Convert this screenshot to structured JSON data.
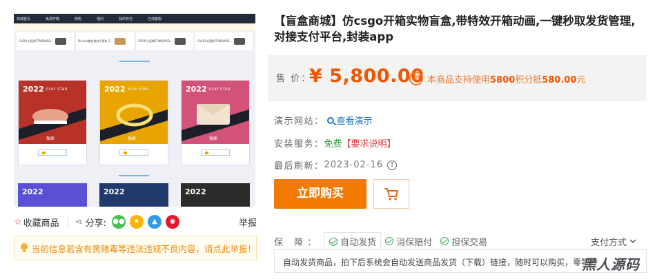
{
  "preview": {
    "nav": [
      "商城首页",
      "免费开箱",
      "换购",
      "福利",
      "我的背包",
      "在线客服"
    ],
    "strip_items": [
      "CASIO卡西欧STANDARD...",
      "Dickies腋包收纳手提包 2...",
      "CASIO卡西欧STANDARD...",
      "CASIO卡西欧STANDARD..."
    ],
    "cards": [
      {
        "year": "2022",
        "tag": "PLAY STAR",
        "color": "#c0392b"
      },
      {
        "year": "2022",
        "tag": "PLAY STAR",
        "color": "#e8a400"
      },
      {
        "year": "2022",
        "tag": "PLAY STAR",
        "color": "#d2527a"
      }
    ],
    "cards_row2": [
      {
        "year": "2022",
        "color": "#5b4fd6"
      },
      {
        "year": "2022",
        "color": "#1f3a6b"
      },
      {
        "year": "2022",
        "color": "#2b2b2b"
      }
    ]
  },
  "share": {
    "favorite_label": "收藏商品",
    "share_label": "分享:",
    "report_label": "举报"
  },
  "warning_text": "当前信息若含有黄赌毒等违法违规不良内容，请点此举报！",
  "product": {
    "title": "【盲盒商城】仿csgo开箱实物盲盒,带特效开箱动画,一键秒取发货管理,对接支付平台,封装app",
    "price_label": "售  价：",
    "price": "¥ 5,800.00",
    "points_icon_text": "积",
    "points_prefix": "本商品支持使用",
    "points_value": "5800",
    "points_mid": "积分抵",
    "points_amount": "580.00",
    "points_suffix": "元"
  },
  "demo": {
    "label": "演示网站：",
    "link": "查看演示"
  },
  "install": {
    "label": "安装服务：",
    "free": "免费",
    "requirement": "【要求说明】"
  },
  "refresh": {
    "label": "最后刷新：",
    "date": "2023-02-16",
    "info_icon": "!"
  },
  "buttons": {
    "buy": "立即购买"
  },
  "guarantee": {
    "label": "保  障：",
    "tabs": [
      "自动发货",
      "消保赔付",
      "担保交易"
    ],
    "payment": "支付方式",
    "description": "自动发货商品，拍下后系统会自动发送商品发货（下载）链接，随时可以购买，零等待"
  },
  "watermark": "黑人源码",
  "colors": {
    "accent": "#ee5700",
    "buy_button": "#f37a00",
    "link": "#1f73c7",
    "free": "#2e9c3c",
    "warn": "#f08d12"
  }
}
